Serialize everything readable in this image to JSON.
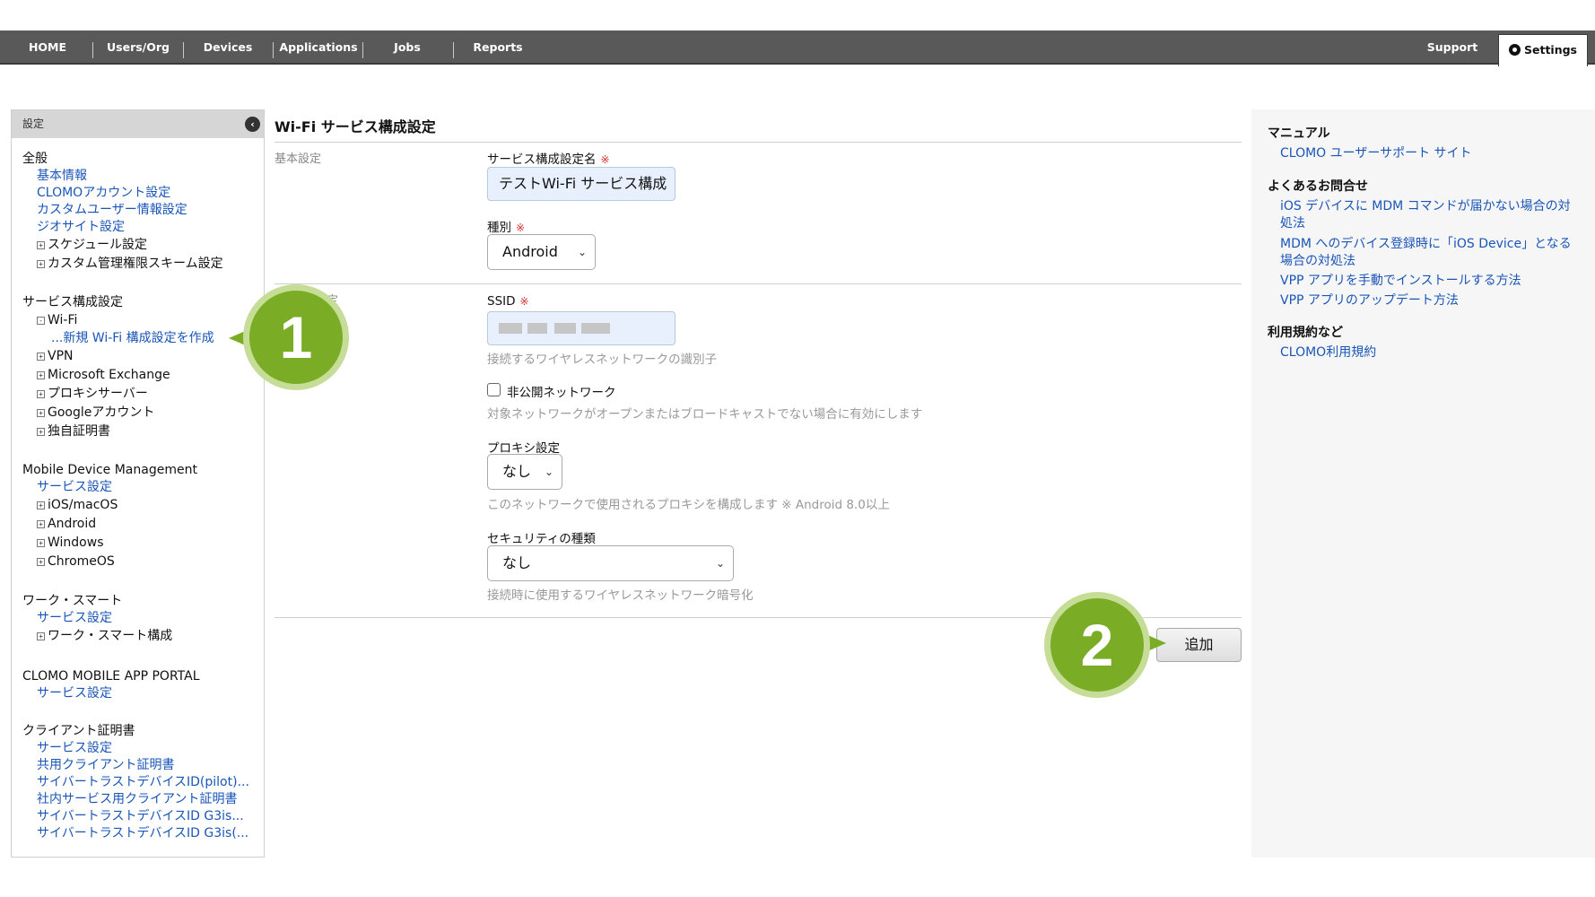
{
  "nav": {
    "items": [
      "HOME",
      "Users/Org",
      "Devices",
      "Applications",
      "Jobs",
      "Reports"
    ],
    "support": "Support",
    "settings": "Settings"
  },
  "sidebar": {
    "header": "設定",
    "groups": [
      {
        "title": "全般",
        "links": [
          "基本情報",
          "CLOMOアカウント設定",
          "カスタムユーザー情報設定",
          "ジオサイト設定"
        ],
        "tree": [
          "スケジュール設定",
          "カスタム管理権限スキーム設定"
        ]
      },
      {
        "title": "サービス構成設定",
        "tree_expanded": "Wi-Fi",
        "sub_link": "...新規 Wi-Fi 構成設定を作成",
        "tree": [
          "VPN",
          "Microsoft Exchange",
          "プロキシサーバー",
          "Googleアカウント",
          "独自証明書"
        ]
      },
      {
        "title": "Mobile Device Management",
        "links": [
          "サービス設定"
        ],
        "tree": [
          "iOS/macOS",
          "Android",
          "Windows",
          "ChromeOS"
        ]
      },
      {
        "title": "ワーク・スマート",
        "links": [
          "サービス設定"
        ],
        "tree": [
          "ワーク・スマート構成"
        ]
      },
      {
        "title": "CLOMO MOBILE APP PORTAL",
        "links": [
          "サービス設定"
        ]
      },
      {
        "title": "クライアント証明書",
        "links": [
          "サービス設定",
          "共用クライアント証明書",
          "サイバートラストデバイスID(pilot)...",
          "社内サービス用クライアント証明書",
          "サイバートラストデバイスID G3is...",
          "サイバートラストデバイスID G3is(..."
        ]
      }
    ]
  },
  "main": {
    "title": "Wi-Fi サービス構成設定",
    "section_basic": "基本設定",
    "section_second_partial": "定",
    "fields": {
      "name_label": "サービス構成設定名",
      "name_value": "テストWi-Fi サービス構成",
      "type_label": "種別",
      "type_value": "Android",
      "ssid_label": "SSID",
      "ssid_hint": "接続するワイヤレスネットワークの識別子",
      "hidden_label": "非公開ネットワーク",
      "hidden_hint": "対象ネットワークがオープンまたはブロードキャストでない場合に有効にします",
      "proxy_label": "プロキシ設定",
      "proxy_value": "なし",
      "proxy_hint": "このネットワークで使用されるプロキシを構成します ※ Android 8.0以上",
      "security_label": "セキュリティの種類",
      "security_value": "なし",
      "security_hint": "接続時に使用するワイヤレスネットワーク暗号化"
    },
    "required_mark": "※",
    "add_button": "追加"
  },
  "markers": {
    "one": "1",
    "two": "2"
  },
  "right_panel": {
    "manual_title": "マニュアル",
    "manual_link": "CLOMO ユーザーサポート サイト",
    "faq_title": "よくあるお問合せ",
    "faq_links": [
      "iOS デバイスに MDM コマンドが届かない場合の対処法",
      "MDM へのデバイス登録時に「iOS Device」となる場合の対処法",
      "VPP アプリを手動でインストールする方法",
      "VPP アプリのアップデート方法"
    ],
    "terms_title": "利用規約など",
    "terms_link": "CLOMO利用規約"
  },
  "colors": {
    "accent_link": "#1a55b8",
    "nav_bg": "#595959",
    "marker": "#7aad25",
    "required": "#d0312d"
  }
}
